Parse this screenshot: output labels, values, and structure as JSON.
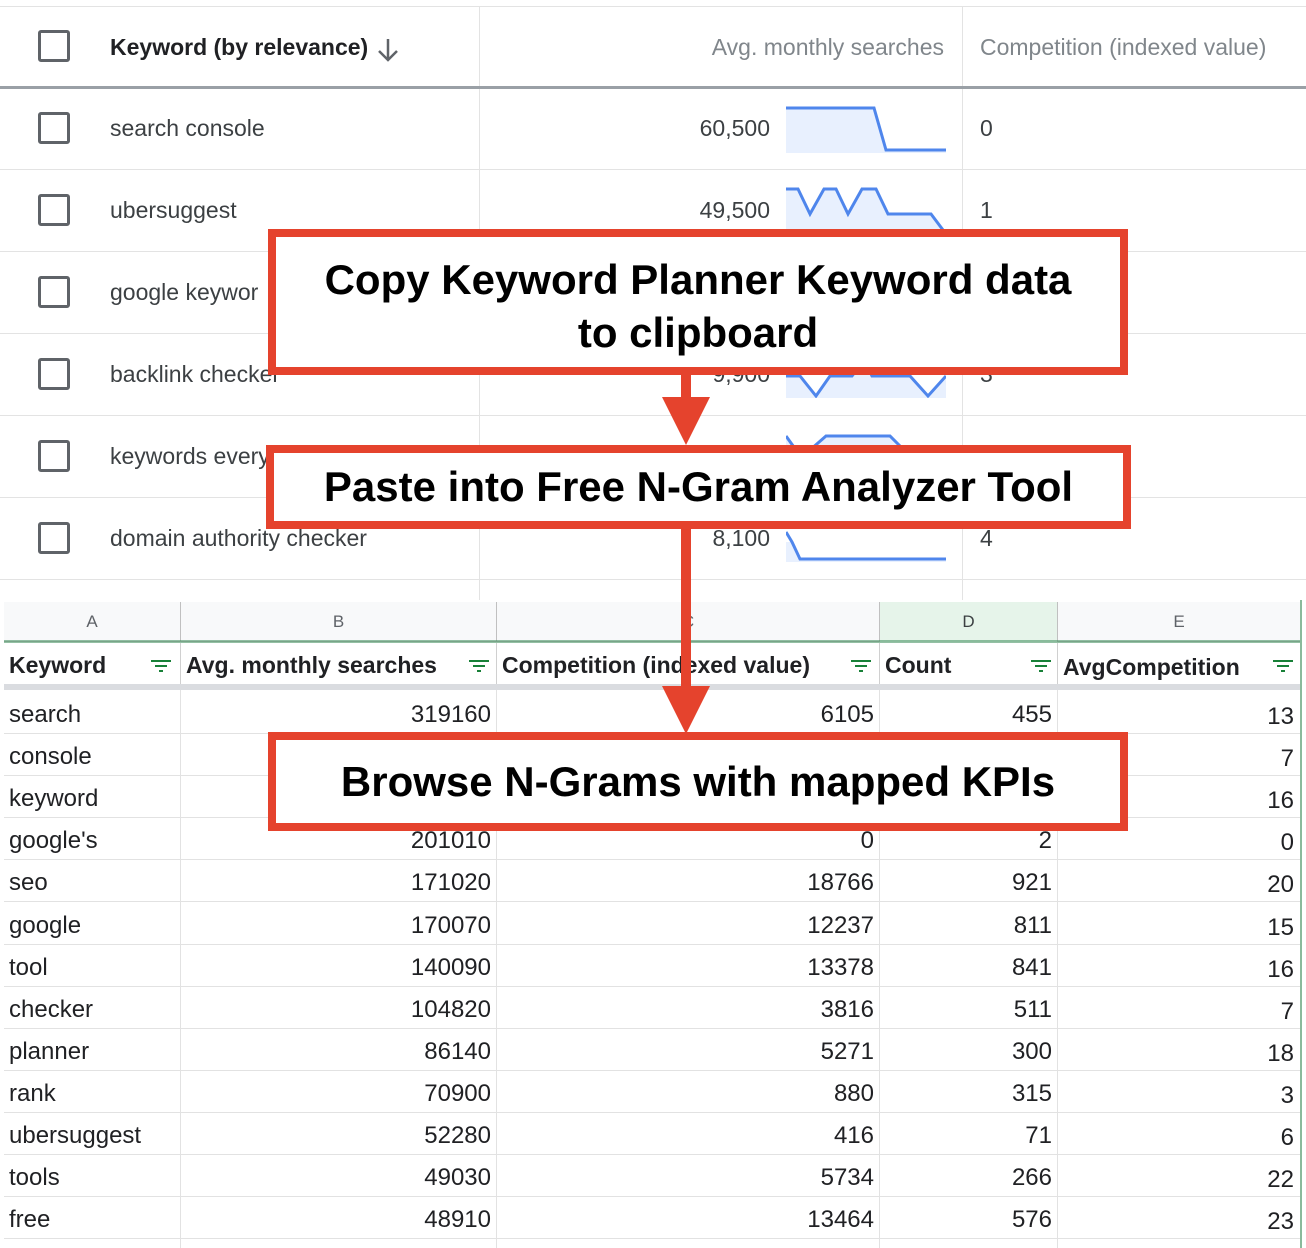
{
  "keyword_planner": {
    "header": {
      "keyword": "Keyword (by relevance)",
      "searches": "Avg. monthly searches",
      "competition": "Competition (indexed value)"
    },
    "rows": [
      {
        "keyword": "search console",
        "searches": "60,500",
        "competition": "0"
      },
      {
        "keyword": "ubersuggest",
        "searches": "49,500",
        "competition": "1"
      },
      {
        "keyword": "google keywor",
        "searches": "",
        "competition": ""
      },
      {
        "keyword": "backlink checker",
        "searches": "9,900",
        "competition": "3"
      },
      {
        "keyword": "keywords every",
        "searches": "",
        "competition": ""
      },
      {
        "keyword": "domain authority checker",
        "searches": "8,100",
        "competition": "4"
      }
    ]
  },
  "sheet": {
    "column_letters": [
      "A",
      "B",
      "C",
      "D",
      "E"
    ],
    "header": [
      "Keyword",
      "Avg. monthly searches",
      "Competition (indexed value)",
      "Count",
      "AvgCompetition"
    ],
    "rows": [
      {
        "keyword": "search",
        "searches": "319160",
        "competition": "6105",
        "count": "455",
        "avg": "13"
      },
      {
        "keyword": "console",
        "searches": "",
        "competition": "",
        "count": "",
        "avg": "7"
      },
      {
        "keyword": "keyword",
        "searches": "",
        "competition": "",
        "count": "",
        "avg": "16"
      },
      {
        "keyword": "google's",
        "searches": "201010",
        "competition": "0",
        "count": "2",
        "avg": "0"
      },
      {
        "keyword": "seo",
        "searches": "171020",
        "competition": "18766",
        "count": "921",
        "avg": "20"
      },
      {
        "keyword": "google",
        "searches": "170070",
        "competition": "12237",
        "count": "811",
        "avg": "15"
      },
      {
        "keyword": "tool",
        "searches": "140090",
        "competition": "13378",
        "count": "841",
        "avg": "16"
      },
      {
        "keyword": "checker",
        "searches": "104820",
        "competition": "3816",
        "count": "511",
        "avg": "7"
      },
      {
        "keyword": "planner",
        "searches": "86140",
        "competition": "5271",
        "count": "300",
        "avg": "18"
      },
      {
        "keyword": "rank",
        "searches": "70900",
        "competition": "880",
        "count": "315",
        "avg": "3"
      },
      {
        "keyword": "ubersuggest",
        "searches": "52280",
        "competition": "416",
        "count": "71",
        "avg": "6"
      },
      {
        "keyword": "tools",
        "searches": "49030",
        "competition": "5734",
        "count": "266",
        "avg": "22"
      },
      {
        "keyword": "free",
        "searches": "48910",
        "competition": "13464",
        "count": "576",
        "avg": "23"
      }
    ]
  },
  "annotations": {
    "step1_line1": "Copy Keyword Planner Keyword data",
    "step1_line2": "to clipboard",
    "step2": "Paste into Free N-Gram Analyzer Tool",
    "step3": "Browse N-Grams with mapped KPIs"
  },
  "colors": {
    "callout_border": "#e5432d",
    "sparkline": "#4f86ec",
    "sparkline_fill": "#e8f0fe"
  }
}
